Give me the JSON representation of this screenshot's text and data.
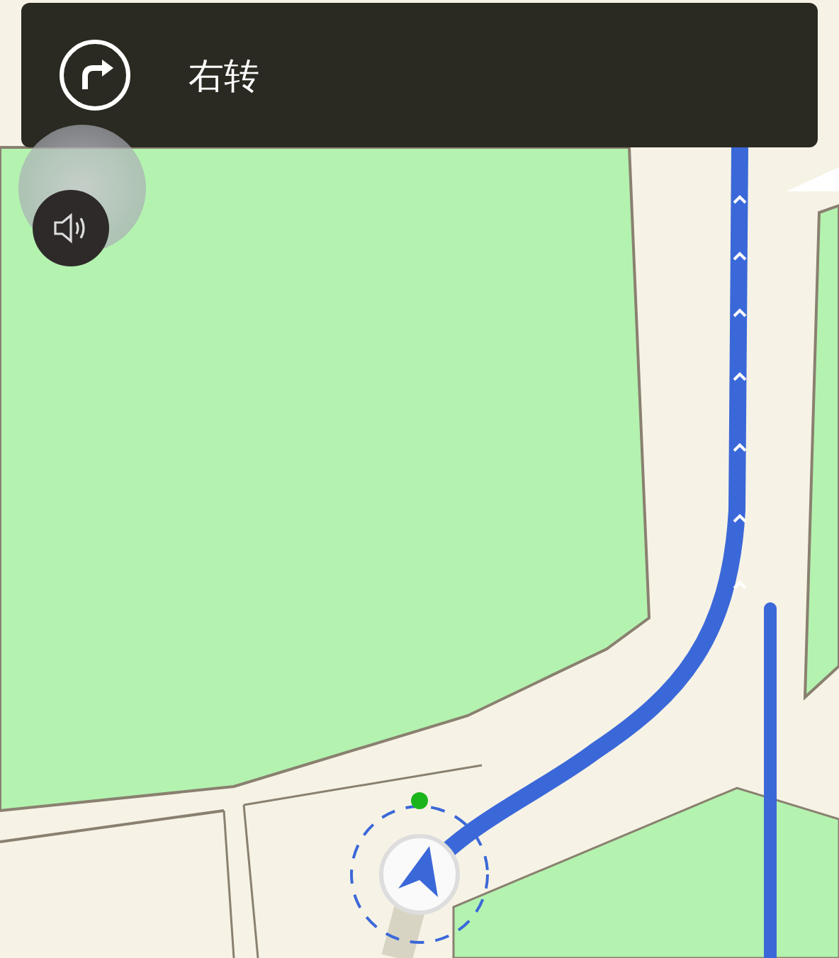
{
  "instruction": {
    "text": "右转"
  }
}
